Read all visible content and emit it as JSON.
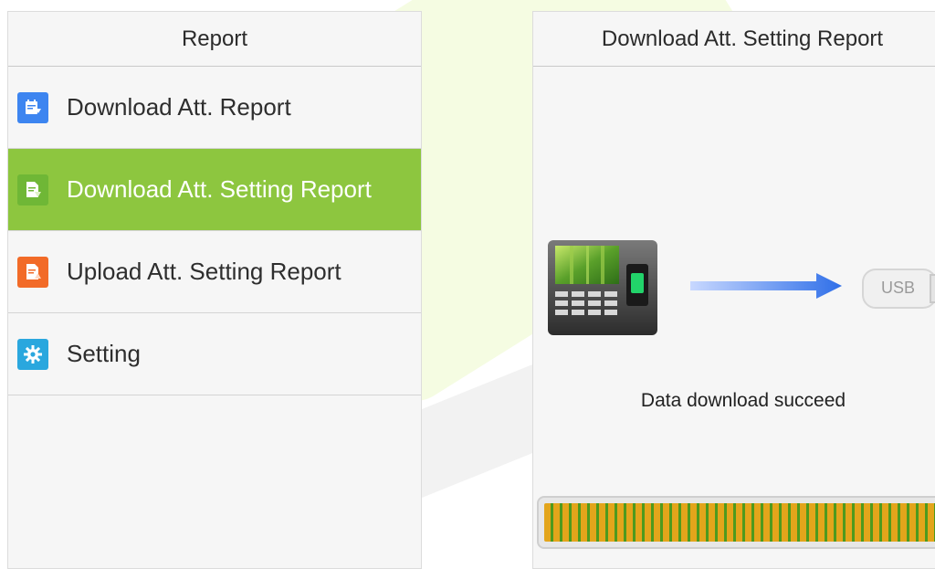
{
  "left_panel": {
    "title": "Report",
    "items": [
      {
        "label": "Download Att. Report",
        "icon": "download-report-icon",
        "icon_color": "#3d85f0"
      },
      {
        "label": "Download Att. Setting Report",
        "icon": "download-setting-icon",
        "icon_color": "#6fb736",
        "active": true
      },
      {
        "label": "Upload Att. Setting Report",
        "icon": "upload-setting-icon",
        "icon_color": "#f26b28"
      },
      {
        "label": "Setting",
        "icon": "gear-icon",
        "icon_color": "#2aa7de"
      }
    ]
  },
  "right_panel": {
    "title": "Download Att. Setting Report",
    "usb_label": "USB",
    "status": "Data download succeed",
    "progress": 1.0
  },
  "colors": {
    "active": "#8dc63f",
    "progress_orange": "#e3a51b",
    "progress_green": "#4e9a1e"
  }
}
